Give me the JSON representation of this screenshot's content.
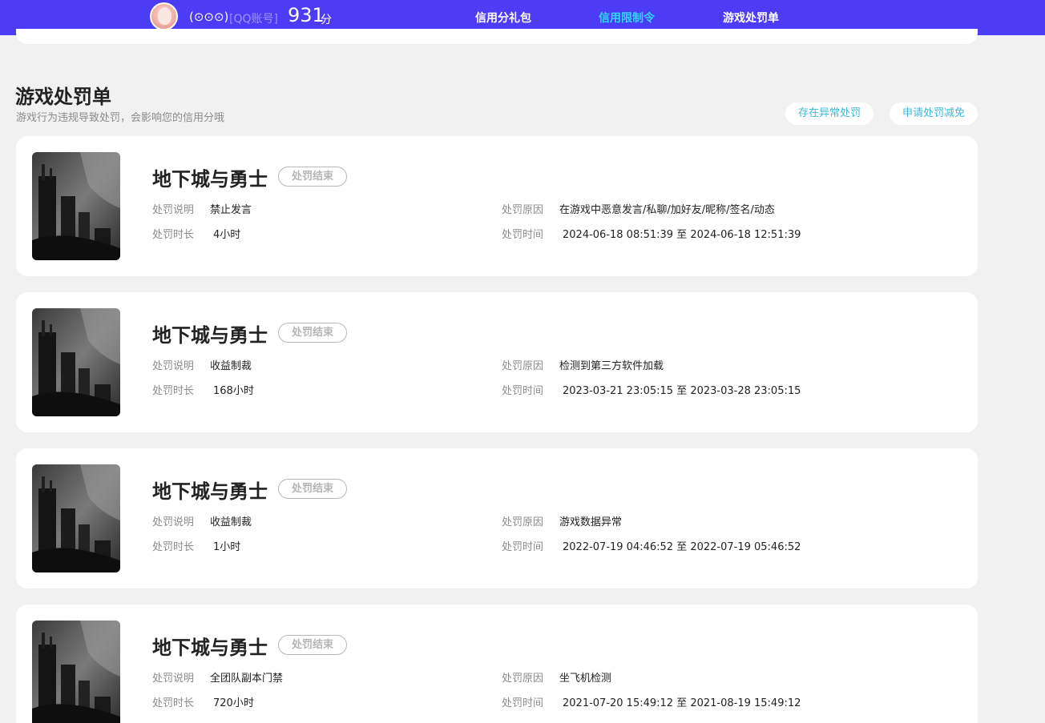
{
  "header": {
    "nickname": "(⊙⊙⊙)",
    "account_label": "[QQ账号]",
    "score": "931",
    "score_unit": "分",
    "tabs": [
      {
        "label": "信用分礼包",
        "active": false
      },
      {
        "label": "信用限制令",
        "active": true
      },
      {
        "label": "游戏处罚单",
        "active": false
      }
    ],
    "accent_color": "#4c3cf5",
    "active_color": "#32d6ff"
  },
  "section": {
    "title": "游戏处罚单",
    "subtitle": "游戏行为违规导致处罚，会影响您的信用分哦",
    "actions": [
      "存在异常处罚",
      "申请处罚减免"
    ]
  },
  "field_labels": {
    "desc": "处罚说明",
    "duration": "处罚时长",
    "reason": "处罚原因",
    "time": "处罚时间"
  },
  "penalties": [
    {
      "game": "地下城与勇士",
      "status": "处罚结束",
      "desc": "禁止发言",
      "duration": "4小时",
      "reason": "在游戏中恶意发言/私聊/加好友/昵称/签名/动态",
      "time": "2024-06-18 08:51:39 至 2024-06-18 12:51:39"
    },
    {
      "game": "地下城与勇士",
      "status": "处罚结束",
      "desc": "收益制裁",
      "duration": "168小时",
      "reason": "检测到第三方软件加载",
      "time": "2023-03-21 23:05:15 至 2023-03-28 23:05:15"
    },
    {
      "game": "地下城与勇士",
      "status": "处罚结束",
      "desc": "收益制裁",
      "duration": "1小时",
      "reason": "游戏数据异常",
      "time": "2022-07-19 04:46:52 至 2022-07-19 05:46:52"
    },
    {
      "game": "地下城与勇士",
      "status": "处罚结束",
      "desc": "全团队副本门禁",
      "duration": "720小时",
      "reason": "坐飞机检测",
      "time": "2021-07-20 15:49:12 至 2021-08-19 15:49:12"
    }
  ]
}
